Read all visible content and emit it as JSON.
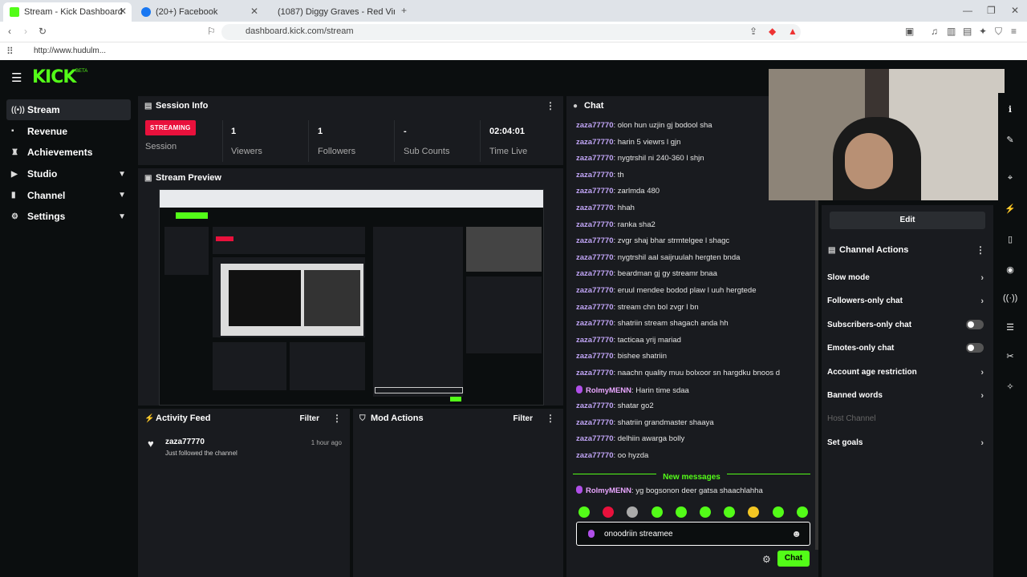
{
  "browser": {
    "tabs": [
      {
        "title": "Stream - Kick Dashboard",
        "active": true
      },
      {
        "title": "(20+) Facebook"
      },
      {
        "title": "(1087) Diggy Graves - Red Viney..."
      }
    ],
    "url": "dashboard.kick.com/stream",
    "bookmark": "http://www.hudulm..."
  },
  "app": {
    "logo": "KICK",
    "logo_badge": "BETA",
    "accent": "#53fc18"
  },
  "nav": {
    "items": [
      {
        "label": "Stream",
        "icon": "stream-icon"
      },
      {
        "label": "Revenue",
        "icon": "dollar-icon"
      },
      {
        "label": "Achievements",
        "icon": "trophy-icon"
      },
      {
        "label": "Studio",
        "icon": "studio-icon"
      },
      {
        "label": "Channel",
        "icon": "channel-icon"
      },
      {
        "label": "Settings",
        "icon": "gear-icon"
      }
    ]
  },
  "session": {
    "title": "Session Info",
    "status": "STREAMING",
    "status_label": "Session",
    "viewers": "1",
    "viewers_label": "Viewers",
    "followers": "1",
    "followers_label": "Followers",
    "subs": "-",
    "subs_label": "Sub Counts",
    "time": "02:04:01",
    "time_label": "Time Live"
  },
  "preview": {
    "title": "Stream Preview"
  },
  "activity": {
    "title": "Activity Feed",
    "filter": "Filter",
    "item_user": "zaza77770",
    "item_time": "1 hour ago",
    "item_text": "Just followed the channel"
  },
  "mod": {
    "title": "Mod Actions",
    "filter": "Filter"
  },
  "chat": {
    "title": "Chat",
    "messages": [
      {
        "user": "zaza77770",
        "text": ": olon hun uzjin gj bodool sha"
      },
      {
        "user": "zaza77770",
        "text": ": harin 5 viewrs l gjn"
      },
      {
        "user": "zaza77770",
        "text": ": nygtrshil ni 240-360 l shjn"
      },
      {
        "user": "zaza77770",
        "text": ": th"
      },
      {
        "user": "zaza77770",
        "text": ": zarlmda 480"
      },
      {
        "user": "zaza77770",
        "text": ": hhah"
      },
      {
        "user": "zaza77770",
        "text": ": ranka sha2"
      },
      {
        "user": "zaza77770",
        "text": ": zvgr shaj bhar strmtelgee l shagc"
      },
      {
        "user": "zaza77770",
        "text": ": nygtrshil aal saijruulah hergten bnda"
      },
      {
        "user": "zaza77770",
        "text": ": beardman gj gy streamr bnaa"
      },
      {
        "user": "zaza77770",
        "text": ": eruul mendee bodod plaw l uuh hergtede"
      },
      {
        "user": "zaza77770",
        "text": ": stream chn bol zvgr l bn"
      },
      {
        "user": "zaza77770",
        "text": ": shatriin stream shagach anda hh"
      },
      {
        "user": "zaza77770",
        "text": ": tacticaa yrij mariad"
      },
      {
        "user": "zaza77770",
        "text": ": bishee shatriin"
      },
      {
        "user": "zaza77770",
        "text": ": naachn quality muu bolxoor sn hargdku bnoos d"
      },
      {
        "user": "RolmyMENN",
        "text": ": Harin time sdaa",
        "mod": true
      },
      {
        "user": "zaza77770",
        "text": ": shatar go2"
      },
      {
        "user": "zaza77770",
        "text": ": shatriin grandmaster shaaya"
      },
      {
        "user": "zaza77770",
        "text": ": delhiin awarga bolly"
      },
      {
        "user": "zaza77770",
        "text": ": oo hyzda"
      }
    ],
    "new_messages": "New messages",
    "new_message": {
      "user": "RolmyMENN",
      "text": ": yg bogsonon deer gatsa shaachlahha"
    },
    "input_value": "onoodriin streamee",
    "send": "Chat"
  },
  "channel": {
    "edit": "Edit",
    "actions_title": "Channel Actions",
    "rows": [
      {
        "label": "Slow mode",
        "kind": "arrow"
      },
      {
        "label": "Followers-only chat",
        "kind": "arrow"
      },
      {
        "label": "Subscribers-only chat",
        "kind": "toggle"
      },
      {
        "label": "Emotes-only chat",
        "kind": "toggle"
      },
      {
        "label": "Account age restriction",
        "kind": "arrow"
      },
      {
        "label": "Banned words",
        "kind": "arrow"
      },
      {
        "label": "Host Channel",
        "kind": "disabled"
      },
      {
        "label": "Set goals",
        "kind": "arrow"
      }
    ]
  }
}
